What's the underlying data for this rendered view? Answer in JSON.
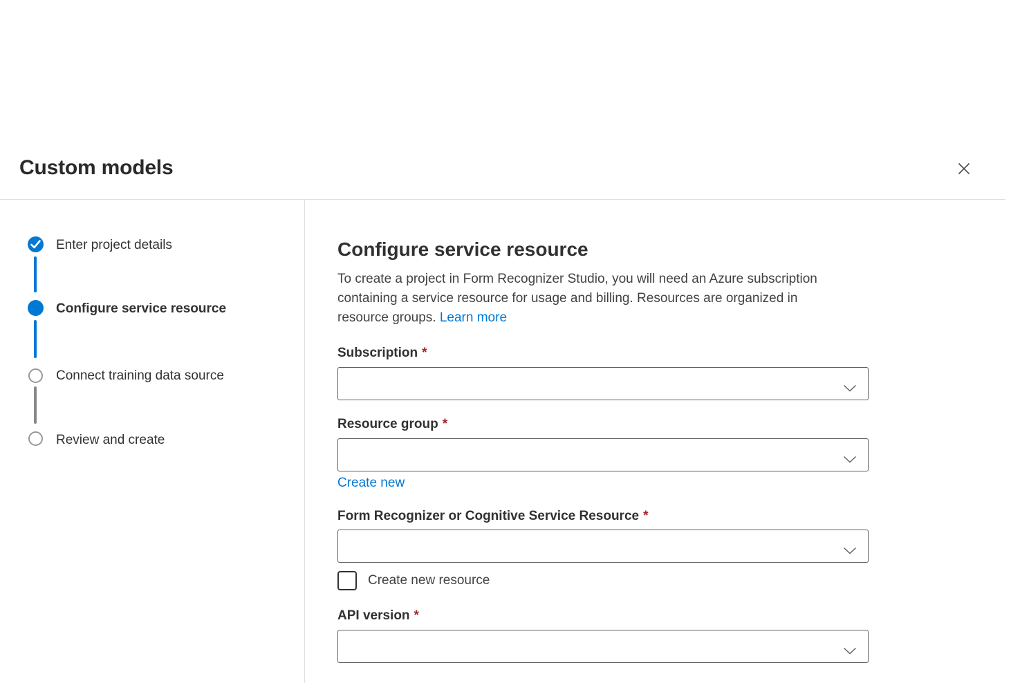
{
  "dialog": {
    "title": "Custom models"
  },
  "stepper": {
    "steps": [
      {
        "label": "Enter project details",
        "state": "completed"
      },
      {
        "label": "Configure service resource",
        "state": "active"
      },
      {
        "label": "Connect training data source",
        "state": "upcoming"
      },
      {
        "label": "Review and create",
        "state": "upcoming"
      }
    ]
  },
  "content": {
    "heading": "Configure service resource",
    "description": {
      "line1": "To create a project in Form Recognizer Studio, you will need an Azure subscription",
      "line2": "containing a service resource for usage and billing. Resources are organized in",
      "line3_prefix": "resource groups. ",
      "learn_more_label": "Learn more"
    },
    "fields": {
      "subscription": {
        "label": "Subscription",
        "required_marker": "*",
        "value": ""
      },
      "resource_group": {
        "label": "Resource group",
        "required_marker": "*",
        "value": "",
        "create_new_label": "Create new"
      },
      "service_resource": {
        "label": "Form Recognizer or Cognitive Service Resource",
        "required_marker": "*",
        "value": ""
      },
      "create_new_resource": {
        "label": "Create new resource",
        "checked": false
      },
      "api_version": {
        "label": "API version",
        "required_marker": "*",
        "value": ""
      }
    }
  },
  "icons": {
    "close": "✕",
    "check": "✓",
    "chevron_down": "⌄"
  },
  "colors": {
    "accent_blue": "#0078d4",
    "link_blue": "#0078d4",
    "required_red": "#a4262c",
    "text_primary": "#323130",
    "text_secondary": "#424242",
    "divider": "#e1dfdd",
    "field_border": "#605e5c",
    "step_upcoming_gray": "#9a9896",
    "connector_gray": "#8a8886"
  }
}
